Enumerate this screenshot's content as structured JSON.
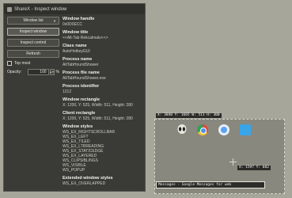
{
  "window": {
    "title": "ShareX - Inspect window",
    "buttons": [
      "Window list",
      "Inspect window",
      "Inspect control",
      "Refresh"
    ],
    "topmost_label": "Top most",
    "opacity_label": "Opacity:",
    "opacity_value": "100",
    "opacity_unit": "%",
    "sections": [
      {
        "label": "Window handle",
        "values": [
          "0x0D0ECC"
        ]
      },
      {
        "label": "Window title",
        "values": [
          "<<Alt-Tab Rekcalmalu<<>"
        ]
      },
      {
        "label": "Class name",
        "values": [
          "AutoHotkeyGUI"
        ]
      },
      {
        "label": "Process name",
        "values": [
          "AltTabHoundShower"
        ]
      },
      {
        "label": "Process file name",
        "values": [
          "AltTabHoundShower.exe"
        ]
      },
      {
        "label": "Process identifier",
        "values": [
          "1212"
        ]
      },
      {
        "label": "Window rectangle",
        "values": [
          "X: 1200, Y: 525, Width: 511, Height: 280"
        ]
      },
      {
        "label": "Client rectangle",
        "values": [
          "X: 1200, Y: 525, Width: 511, Height: 280"
        ]
      },
      {
        "label": "Window styles",
        "values": [
          "WS_EX_RIGHTSCROLLBAR",
          "WS_EX_LEFT",
          "WS_EX_TILED",
          "WS_EX_LTRREADING",
          "WS_EX_STATICEDGE",
          "WS_EX_LAYERED",
          "WS_CLIPSIBLINGS",
          "WS_VISIBLE",
          "WS_POPUP"
        ]
      },
      {
        "label": "Extended window styles",
        "values": [
          "WS_EX_OVERLAPPED"
        ]
      }
    ]
  },
  "overlay": {
    "coord_top": "X: 3848 Y: 1665 W: 511 H: 300",
    "coord_mid": "X: 1597 Y: 682",
    "message_bar": "Messages - Google Messages for web"
  }
}
